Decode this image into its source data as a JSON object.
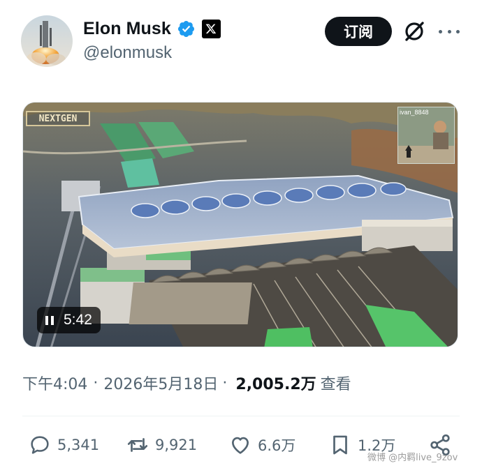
{
  "user": {
    "name": "Elon Musk",
    "handle": "@elonmusk",
    "subscribe_label": "订阅"
  },
  "media": {
    "brand_text": "NEXTGEN",
    "pip_label": "ivan_8848",
    "duration": "5:42"
  },
  "meta": {
    "time": "下午4:04",
    "separator": "·",
    "date": "2026年5月18日",
    "views": "2,005.2万",
    "views_label": "查看"
  },
  "actions": {
    "replies": "5,341",
    "reposts": "9,921",
    "likes": "6.6万",
    "bookmarks": "1.2万"
  },
  "watermark": "微博 @内羁live_9zov",
  "icons": [
    "verified-badge-icon",
    "x-logo-icon",
    "grok-icon",
    "more-icon",
    "pause-icon",
    "reply-icon",
    "repost-icon",
    "like-icon",
    "bookmark-icon",
    "share-icon"
  ],
  "colors": {
    "verified": "#1d9bf0",
    "text": "#0f1419",
    "muted": "#536471"
  }
}
